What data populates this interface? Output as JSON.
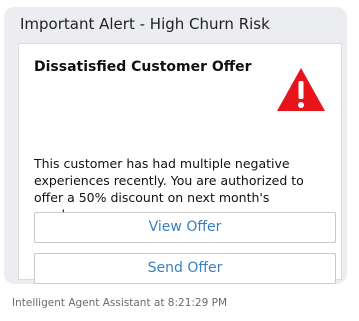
{
  "alert": {
    "title": "Important Alert - High Churn Risk"
  },
  "card": {
    "heading": "Dissatisfied Customer Offer",
    "icon": "warning-triangle-icon",
    "icon_color": "#e8141c",
    "body": "This customer has had multiple negative experiences recently. You are authorized to offer a 50% discount on next month's purchases",
    "buttons": {
      "view_label": "View Offer",
      "send_label": "Send Offer"
    },
    "accent_color": "#3a7fc4"
  },
  "footer": {
    "sender": "Intelligent Agent Assistant at 8:21:29 PM"
  }
}
